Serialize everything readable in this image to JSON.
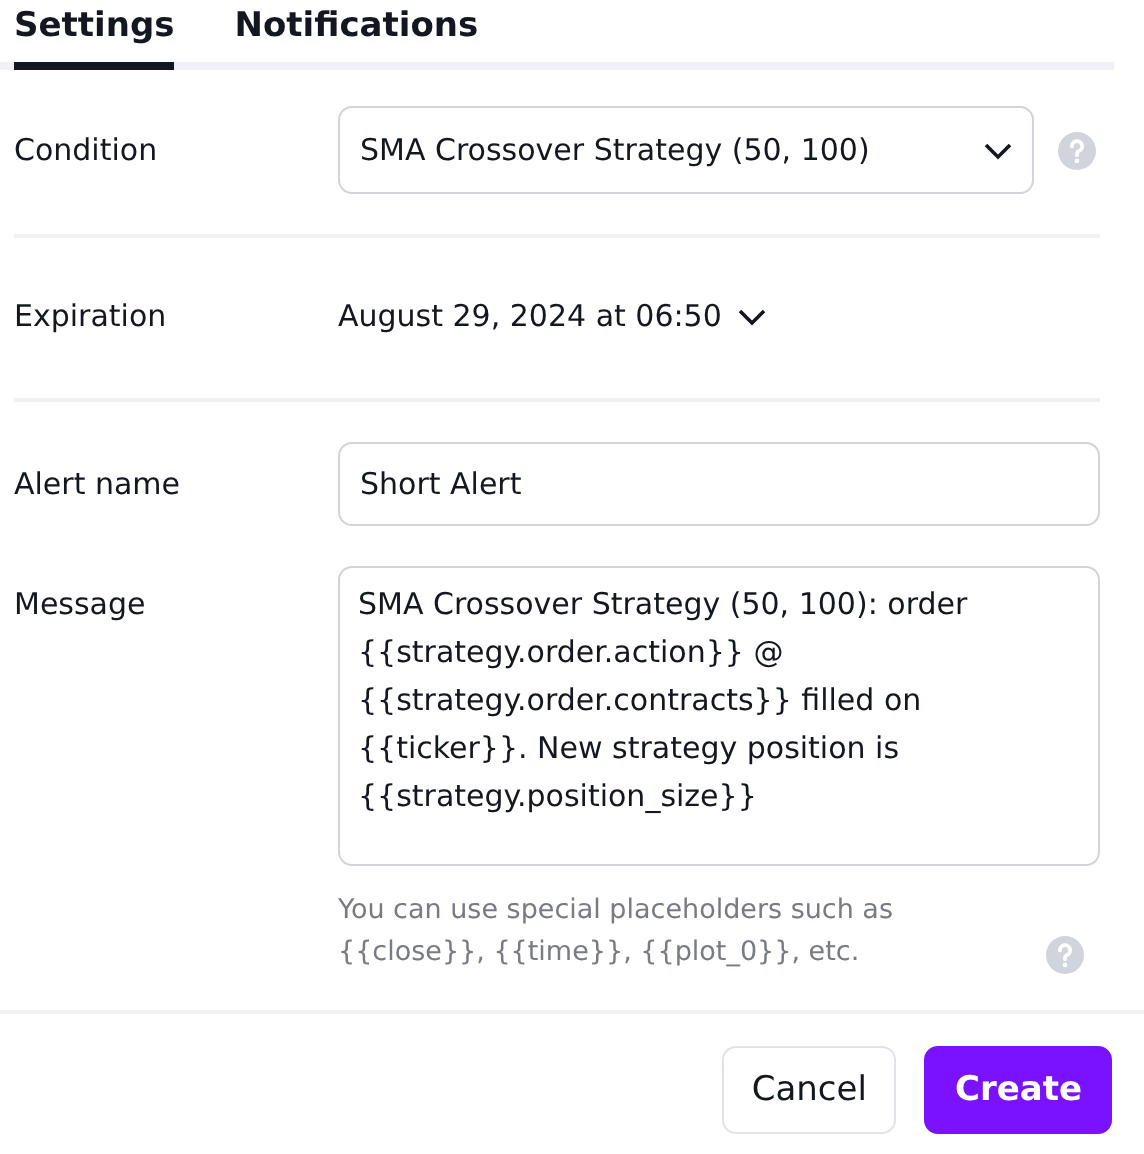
{
  "tabs": [
    {
      "label": "Settings",
      "selected": true
    },
    {
      "label": "Notifications",
      "selected": false
    }
  ],
  "condition": {
    "label": "Condition",
    "value": "SMA Crossover Strategy (50, 100)"
  },
  "expiration": {
    "label": "Expiration",
    "value": "August 29, 2024 at 06:50"
  },
  "alert_name": {
    "label": "Alert name",
    "value": "Short Alert"
  },
  "message": {
    "label": "Message",
    "value": "SMA Crossover Strategy (50, 100): order {{strategy.order.action}} @ {{strategy.order.contracts}} filled on {{ticker}}. New strategy position is {{strategy.position_size}}",
    "hint": "You can use special placeholders such as {{close}}, {{time}}, {{plot_0}}, etc."
  },
  "buttons": [
    {
      "label": "Cancel",
      "kind": "secondary"
    },
    {
      "label": "Create",
      "kind": "primary"
    }
  ]
}
